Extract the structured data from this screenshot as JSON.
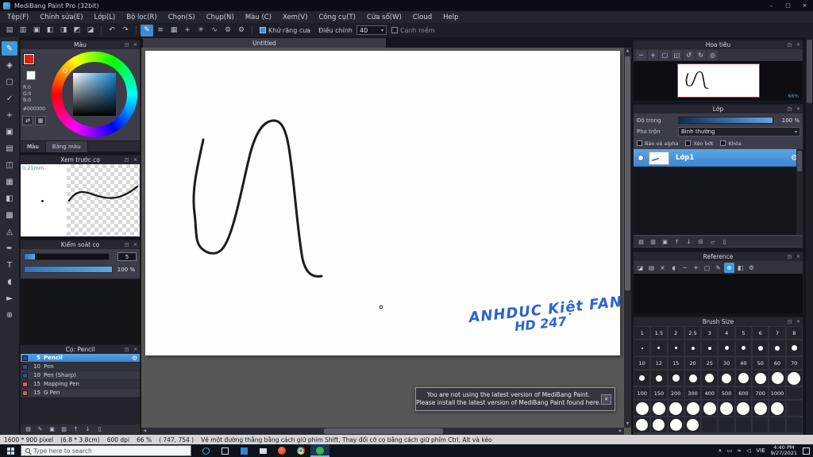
{
  "ui": {
    "caret": "▾",
    "scroll_up": "▲",
    "scroll_down": "▼",
    "scroll_left": "◀",
    "scroll_right": "▶",
    "popout": "◳",
    "close": "×"
  },
  "window": {
    "title": "MediBang Paint Pro (32bit)",
    "minimize": "–",
    "maximize": "▢",
    "close": "×"
  },
  "menubar": {
    "items": [
      "Tệp(F)",
      "Chỉnh sửa(E)",
      "Lớp(L)",
      "Bộ lọc(R)",
      "Chọn(S)",
      "Chụp(N)",
      "Màu (C)",
      "Xem(V)",
      "Công cụ(T)",
      "Cửa sổ(W)",
      "Cloud",
      "Help"
    ]
  },
  "toolbar": {
    "file_icons": [
      {
        "name": "new-canvas-icon",
        "glyph": "▤"
      },
      {
        "name": "open-icon",
        "glyph": "▥"
      },
      {
        "name": "save-icon",
        "glyph": "▣"
      },
      {
        "name": "window-layout-1-icon",
        "glyph": "◧"
      },
      {
        "name": "window-layout-2-icon",
        "glyph": "◨"
      },
      {
        "name": "window-layout-3-icon",
        "glyph": "◩"
      },
      {
        "name": "window-layout-4-icon",
        "glyph": "◪"
      }
    ],
    "history_icons": [
      {
        "name": "undo-icon",
        "glyph": "↶"
      },
      {
        "name": "redo-icon",
        "glyph": "↷"
      }
    ],
    "snap_icons": [
      {
        "name": "pen-icon",
        "glyph": "✎",
        "selected": true
      },
      {
        "name": "parallel-snap-icon",
        "glyph": "≡"
      },
      {
        "name": "grid-snap-icon",
        "glyph": "▦"
      },
      {
        "name": "cross-snap-icon",
        "glyph": "+"
      },
      {
        "name": "radial-snap-icon",
        "glyph": "✳"
      },
      {
        "name": "curve-snap-icon",
        "glyph": "∿"
      },
      {
        "name": "snap-settings-icon",
        "glyph": "⚙"
      },
      {
        "name": "material-icon",
        "glyph": "⚙"
      }
    ],
    "antialias_label": "Khử răng cưa",
    "adjust_label": "Điều chỉnh",
    "adjust_value": "40",
    "soft_edge_label": "Cạnh mềm"
  },
  "tools": {
    "items": [
      {
        "name": "brush-tool",
        "glyph": "✎",
        "selected": true
      },
      {
        "name": "eraser-tool",
        "glyph": "◈"
      },
      {
        "name": "select-rect-tool",
        "glyph": "▢"
      },
      {
        "name": "select-pen-tool",
        "glyph": "✓"
      },
      {
        "name": "move-tool",
        "glyph": "+"
      },
      {
        "name": "fill-tool",
        "glyph": "▣"
      },
      {
        "name": "gradient-tool",
        "glyph": "▤"
      },
      {
        "name": "panel-divide-tool",
        "glyph": "◫"
      },
      {
        "name": "grid-tool",
        "glyph": "▦"
      },
      {
        "name": "frame-tool",
        "glyph": "◧"
      },
      {
        "name": "halftone-tool",
        "glyph": "▩"
      },
      {
        "name": "smudge-tool",
        "glyph": "◬"
      },
      {
        "name": "pen-edit-tool",
        "glyph": "✒"
      },
      {
        "name": "text-tool",
        "glyph": "T"
      },
      {
        "name": "eyedropper-tool",
        "glyph": "◖"
      },
      {
        "name": "operation-tool",
        "glyph": "►"
      },
      {
        "name": "hand-tool",
        "glyph": "⊕"
      }
    ]
  },
  "color_panel": {
    "title": "Màu",
    "r_label": "R:0",
    "g_label": "G:0",
    "b_label": "B:0",
    "hex": "#000000",
    "small_icons": [
      {
        "name": "swap-colors-icon",
        "glyph": "⇄"
      },
      {
        "name": "palette-grid-icon",
        "glyph": "▦"
      }
    ],
    "tabs": [
      {
        "name": "tab-mau",
        "label": "Màu",
        "selected": true
      },
      {
        "name": "tab-bang-mau",
        "label": "Bảng màu"
      }
    ]
  },
  "preview_panel": {
    "title": "Xem trước cọ",
    "size_label": "0.21mm"
  },
  "control_panel": {
    "title": "Kiểm soát cọ",
    "size_value": "5",
    "opacity_value": "100 %"
  },
  "brush_list_panel": {
    "title": "Cọ: Pencil",
    "brushes": [
      {
        "size": "5",
        "name": "Pencil",
        "selected": true,
        "swatch": "#2e4f8f",
        "gear": "⚙"
      },
      {
        "size": "10",
        "name": "Pen",
        "swatch": "#2e4f8f"
      },
      {
        "size": "10",
        "name": "Pen (Sharp)",
        "swatch": "#2e4f8f"
      },
      {
        "size": "15",
        "name": "Mapping Pen",
        "swatch": "#d85c6a"
      },
      {
        "size": "15",
        "name": "G Pen",
        "swatch": "#d85c6a"
      }
    ],
    "footer_icons": [
      {
        "name": "add-brush-icon",
        "glyph": "▤"
      },
      {
        "name": "edit-brush-icon",
        "glyph": "✎"
      },
      {
        "name": "duplicate-brush-icon",
        "glyph": "▣"
      },
      {
        "name": "brush-folder-icon",
        "glyph": "▥"
      },
      {
        "name": "move-brush-up-icon",
        "glyph": "↑"
      },
      {
        "name": "move-brush-down-icon",
        "glyph": "↓"
      },
      {
        "name": "delete-brush-icon",
        "glyph": "▯"
      }
    ]
  },
  "canvas": {
    "tab": "Untitled",
    "signature_line1": "ANHDUC Kiệt FAN",
    "signature_line2": "HD 247"
  },
  "navigator": {
    "title": "Hoa tiêu",
    "zoom_value": "66%",
    "icons": [
      {
        "name": "zoom-out-icon",
        "glyph": "−"
      },
      {
        "name": "zoom-in-icon",
        "glyph": "+"
      },
      {
        "name": "fit-window-icon",
        "glyph": "▢"
      },
      {
        "name": "actual-size-icon",
        "glyph": "◱"
      },
      {
        "name": "rotate-left-icon",
        "glyph": "↺"
      },
      {
        "name": "rotate-right-icon",
        "glyph": "↻"
      },
      {
        "name": "reset-view-icon",
        "glyph": "◎"
      }
    ]
  },
  "layer_panel": {
    "title": "Lớp",
    "opacity_label": "Độ trong",
    "opacity_value": "100 %",
    "blend_label": "Pha trộn",
    "blend_value": "Bình thường",
    "options": [
      {
        "name": "protect-alpha-checkbox",
        "label": "Bảo vệ alpha"
      },
      {
        "name": "clipping-checkbox",
        "label": "Xén bớt"
      },
      {
        "name": "lock-checkbox",
        "label": "Khóa"
      }
    ],
    "layers": [
      {
        "name": "Lớp1",
        "selected": true,
        "gear": "⚙"
      }
    ],
    "footer_icons": [
      {
        "name": "add-layer-icon",
        "glyph": "▤"
      },
      {
        "name": "add-folder-icon",
        "glyph": "▥"
      },
      {
        "name": "duplicate-layer-icon",
        "glyph": "▣"
      },
      {
        "name": "move-layer-up-icon",
        "glyph": "↑"
      },
      {
        "name": "move-layer-down-icon",
        "glyph": "↓"
      },
      {
        "name": "merge-layer-icon",
        "glyph": "⊟"
      },
      {
        "name": "clear-layer-icon",
        "glyph": "▱"
      },
      {
        "name": "delete-layer-icon",
        "glyph": "▯"
      }
    ]
  },
  "reference_panel": {
    "title": "Reference",
    "icons": [
      {
        "name": "pin-icon",
        "glyph": "◪"
      },
      {
        "name": "open-image-icon",
        "glyph": "▤"
      },
      {
        "name": "clear-icon",
        "glyph": "×"
      },
      {
        "name": "eyedropper-icon",
        "glyph": "◖"
      },
      {
        "name": "zoom-out-icon",
        "glyph": "−"
      },
      {
        "name": "zoom-in-icon",
        "glyph": "+"
      },
      {
        "name": "fit-icon",
        "glyph": "▢"
      },
      {
        "name": "pencil-icon",
        "glyph": "✎"
      },
      {
        "name": "hand-icon",
        "glyph": "⊕",
        "selected": true
      },
      {
        "name": "crop-icon",
        "glyph": "◧"
      },
      {
        "name": "settings-icon",
        "glyph": "⚙"
      }
    ]
  },
  "brush_size_panel": {
    "title": "Brush Size",
    "rows": [
      {
        "type": "n",
        "cells": [
          "1",
          "1.5",
          "2",
          "2.5",
          "3",
          "4",
          "5",
          "6",
          "7",
          "8"
        ]
      },
      {
        "type": "c",
        "sizes": [
          2,
          3,
          3,
          4,
          4,
          5,
          5,
          6,
          6,
          7
        ]
      },
      {
        "type": "n",
        "cells": [
          "10",
          "12",
          "15",
          "20",
          "25",
          "30",
          "40",
          "50",
          "60",
          "70"
        ]
      },
      {
        "type": "c",
        "sizes": [
          7,
          8,
          9,
          10,
          11,
          12,
          13,
          14,
          15,
          16
        ]
      },
      {
        "type": "n",
        "cells": [
          "100",
          "150",
          "200",
          "300",
          "400",
          "500",
          "600",
          "700",
          "1000",
          ""
        ]
      },
      {
        "type": "c",
        "sizes": [
          16,
          16,
          16,
          16,
          16,
          16,
          16,
          16,
          16,
          0
        ]
      },
      {
        "type": "c",
        "sizes": [
          15,
          15,
          15,
          15,
          0,
          0,
          0,
          0,
          0,
          0
        ]
      }
    ]
  },
  "notification": {
    "line1": "You are not using the latest version of MediBang Paint.",
    "line2": "Please install the latest version of MediBang Paint found here.",
    "close": "×"
  },
  "statusbar": {
    "segments": [
      "1600 * 900 pixel",
      "(6.8 * 3.8cm)",
      "600 dpi",
      "66 %",
      "( 747, 754 )",
      "Vẽ một đường thẳng bằng cách giữ phím Shift, Thay đổi cỡ cọ bằng cách giữ phím Ctrl, Alt và kéo"
    ]
  },
  "taskbar": {
    "search_placeholder": "Type here to search",
    "tray_icons": [
      {
        "name": "hidden-icons-chevron",
        "glyph": "∧"
      },
      {
        "name": "display-icon",
        "glyph": "▭"
      },
      {
        "name": "network-icon",
        "glyph": "≈"
      },
      {
        "name": "volume-icon",
        "glyph": "◁"
      }
    ],
    "tray_lang": "VIE",
    "time": "4:40 PM",
    "date": "9/27/2021"
  }
}
